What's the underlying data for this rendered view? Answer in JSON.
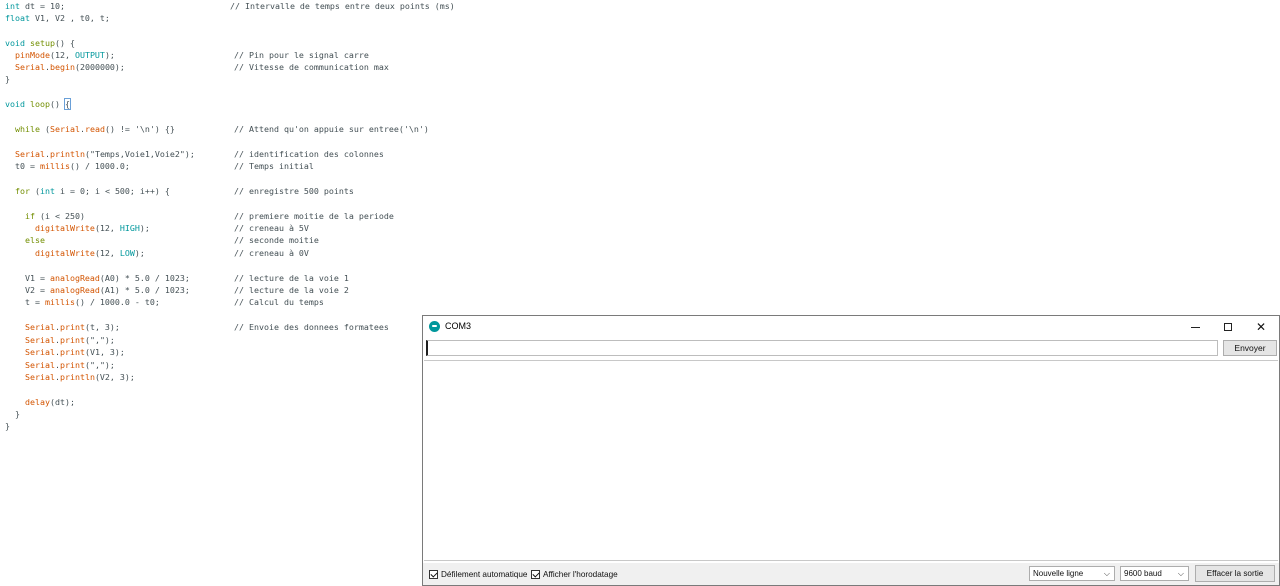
{
  "code": {
    "line1": {
      "a": "int",
      "b": " dt = 10;",
      "comment": "// Intervalle de temps entre deux points (ms)"
    },
    "line2": {
      "a": "float",
      "b": " V1, V2 , t0, t;"
    },
    "line4": {
      "a": "void",
      "b": " ",
      "c": "setup",
      "d": "() {"
    },
    "line5": {
      "a": "  ",
      "b": "pinMode",
      "c": "(12, ",
      "d": "OUTPUT",
      "e": ");",
      "comment": "// Pin pour le signal carre"
    },
    "line6": {
      "a": "  ",
      "b": "Serial",
      "c": ".",
      "d": "begin",
      "e": "(2000000);",
      "comment": "// Vitesse de communication max"
    },
    "line7": "}",
    "line9": {
      "a": "void",
      "b": " ",
      "c": "loop",
      "d": "() ",
      "e": "{"
    },
    "line11": {
      "a": "  ",
      "b": "while",
      "c": " (",
      "d": "Serial",
      "e": ".",
      "f": "read",
      "g": "() != '\\n') {}",
      "comment": "// Attend qu'on appuie sur entree('\\n')"
    },
    "line13": {
      "a": "  ",
      "b": "Serial",
      "c": ".",
      "d": "println",
      "e": "(\"Temps,Voie1,Voie2\");",
      "comment": "// identification des colonnes"
    },
    "line14": {
      "a": "  t0 = ",
      "b": "millis",
      "c": "() / 1000.0;",
      "comment": "// Temps initial"
    },
    "line16": {
      "a": "  ",
      "b": "for",
      "c": " (",
      "d": "int",
      "e": " i = 0; i < 500; i++) {",
      "comment": "// enregistre 500 points"
    },
    "line18": {
      "a": "    ",
      "b": "if",
      "c": " (i < 250)",
      "comment": "// premiere moitie de la periode"
    },
    "line19": {
      "a": "      ",
      "b": "digitalWrite",
      "c": "(12, ",
      "d": "HIGH",
      "e": ");",
      "comment": "// creneau à 5V"
    },
    "line20": {
      "a": "    ",
      "b": "else",
      "comment": "// seconde moitie"
    },
    "line21": {
      "a": "      ",
      "b": "digitalWrite",
      "c": "(12, ",
      "d": "LOW",
      "e": ");",
      "comment": "// creneau à 0V"
    },
    "line23": {
      "a": "    V1 = ",
      "b": "analogRead",
      "c": "(A0) * 5.0 / 1023;",
      "comment": "// lecture de la voie 1"
    },
    "line24": {
      "a": "    V2 = ",
      "b": "analogRead",
      "c": "(A1) * 5.0 / 1023;",
      "comment": "// lecture de la voie 2"
    },
    "line25": {
      "a": "    t = ",
      "b": "millis",
      "c": "() / 1000.0 - t0;",
      "comment": "// Calcul du temps"
    },
    "line27": {
      "a": "    ",
      "b": "Serial",
      "c": ".",
      "d": "print",
      "e": "(t, 3);",
      "comment": "// Envoie des donnees formatees"
    },
    "line28": {
      "a": "    ",
      "b": "Serial",
      "c": ".",
      "d": "print",
      "e": "(\",\");"
    },
    "line29": {
      "a": "    ",
      "b": "Serial",
      "c": ".",
      "d": "print",
      "e": "(V1, 3);"
    },
    "line30": {
      "a": "    ",
      "b": "Serial",
      "c": ".",
      "d": "print",
      "e": "(\",\");"
    },
    "line31": {
      "a": "    ",
      "b": "Serial",
      "c": ".",
      "d": "println",
      "e": "(V2, 3);"
    },
    "line33": {
      "a": "    ",
      "b": "delay",
      "c": "(dt);"
    },
    "line34": "  }",
    "line35": "}"
  },
  "serial_monitor": {
    "title": "COM3",
    "input_value": "",
    "send_label": "Envoyer",
    "autoscroll_label": "Défilement automatique",
    "timestamp_label": "Afficher l'horodatage",
    "line_ending": "Nouvelle ligne",
    "baud_rate": "9600 baud",
    "clear_label": "Effacer la sortie"
  }
}
